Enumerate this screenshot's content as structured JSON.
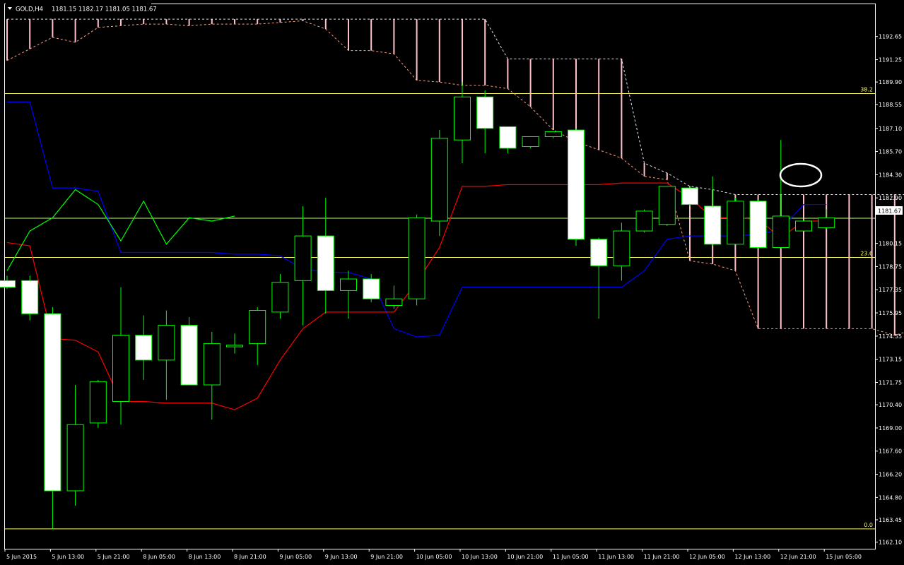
{
  "header": {
    "symbol_label": "GOLD,H4",
    "ohlc_label": "1181.15 1182.17 1181.05 1181.67",
    "dropdown_icon": "triangle-down-icon"
  },
  "colors": {
    "background": "#000000",
    "foreground": "#ffffff",
    "bull_border": "#00ff00",
    "bear_body": "#ffffff",
    "tenkan": "#ff0000",
    "kijun": "#0000ff",
    "chikou": "#00ff00",
    "cloud_hatch": "#ffc0cb",
    "cloud_edge_a": "#ffa07a",
    "cloud_edge_b": "#e6e6fa",
    "level_line": "#ffff66",
    "price_line": "#c0ff80"
  },
  "chart_data": {
    "type": "candlestick",
    "symbol": "GOLD",
    "timeframe": "H4",
    "ylim": [
      1161.7,
      1194.6
    ],
    "y_ticks": [
      "1192.65",
      "1191.25",
      "1189.90",
      "1188.55",
      "1187.10",
      "1185.70",
      "1184.30",
      "1182.90",
      "1181.67",
      "1180.15",
      "1178.75",
      "1177.35",
      "1175.95",
      "1174.55",
      "1173.15",
      "1171.75",
      "1170.40",
      "1169.00",
      "1167.60",
      "1166.20",
      "1164.80",
      "1163.45",
      "1162.10"
    ],
    "x_labels": [
      "5 Jun 2015",
      "5 Jun 13:00",
      "5 Jun 21:00",
      "8 Jun 05:00",
      "8 Jun 13:00",
      "8 Jun 21:00",
      "9 Jun 05:00",
      "9 Jun 13:00",
      "9 Jun 21:00",
      "10 Jun 05:00",
      "10 Jun 13:00",
      "10 Jun 21:00",
      "11 Jun 05:00",
      "11 Jun 13:00",
      "11 Jun 21:00",
      "12 Jun 05:00",
      "12 Jun 13:00",
      "12 Jun 21:00",
      "15 Jun 05:00"
    ],
    "current_price": "1181.67",
    "fib_levels": [
      {
        "label": "38.2",
        "price": 1189.2
      },
      {
        "label": "23.6",
        "price": 1179.3
      },
      {
        "label": "0.0",
        "price": 1162.9
      }
    ],
    "candles": [
      {
        "o": 1177.9,
        "h": 1178.2,
        "l": 1177.4,
        "c": 1177.5
      },
      {
        "o": 1177.9,
        "h": 1178.2,
        "l": 1175.5,
        "c": 1175.9
      },
      {
        "o": 1175.9,
        "h": 1176.3,
        "l": 1162.9,
        "c": 1165.2
      },
      {
        "o": 1165.2,
        "h": 1171.6,
        "l": 1164.3,
        "c": 1169.2
      },
      {
        "o": 1169.3,
        "h": 1171.9,
        "l": 1169.0,
        "c": 1171.8
      },
      {
        "o": 1170.6,
        "h": 1177.5,
        "l": 1169.2,
        "c": 1174.6
      },
      {
        "o": 1174.6,
        "h": 1175.8,
        "l": 1171.9,
        "c": 1173.1
      },
      {
        "o": 1173.1,
        "h": 1176.1,
        "l": 1170.7,
        "c": 1175.2
      },
      {
        "o": 1175.2,
        "h": 1175.7,
        "l": 1171.6,
        "c": 1171.6
      },
      {
        "o": 1171.6,
        "h": 1174.8,
        "l": 1169.5,
        "c": 1174.1
      },
      {
        "o": 1173.9,
        "h": 1174.7,
        "l": 1173.5,
        "c": 1174.0
      },
      {
        "o": 1174.1,
        "h": 1176.3,
        "l": 1172.8,
        "c": 1176.1
      },
      {
        "o": 1176.0,
        "h": 1178.3,
        "l": 1175.6,
        "c": 1177.8
      },
      {
        "o": 1177.9,
        "h": 1182.4,
        "l": 1175.2,
        "c": 1180.6
      },
      {
        "o": 1180.6,
        "h": 1182.9,
        "l": 1175.9,
        "c": 1177.3
      },
      {
        "o": 1177.3,
        "h": 1178.5,
        "l": 1175.6,
        "c": 1178.0
      },
      {
        "o": 1178.0,
        "h": 1178.3,
        "l": 1176.6,
        "c": 1176.8
      },
      {
        "o": 1176.4,
        "h": 1177.6,
        "l": 1176.2,
        "c": 1176.8
      },
      {
        "o": 1176.8,
        "h": 1181.9,
        "l": 1176.4,
        "c": 1181.7
      },
      {
        "o": 1181.5,
        "h": 1187.0,
        "l": 1180.6,
        "c": 1186.5
      },
      {
        "o": 1186.4,
        "h": 1189.9,
        "l": 1185.0,
        "c": 1189.0
      },
      {
        "o": 1189.0,
        "h": 1189.4,
        "l": 1185.6,
        "c": 1187.1
      },
      {
        "o": 1187.2,
        "h": 1187.2,
        "l": 1185.6,
        "c": 1185.9
      },
      {
        "o": 1186.0,
        "h": 1186.6,
        "l": 1185.9,
        "c": 1186.6
      },
      {
        "o": 1186.6,
        "h": 1186.9,
        "l": 1186.5,
        "c": 1186.9
      },
      {
        "o": 1187.0,
        "h": 1187.1,
        "l": 1180.0,
        "c": 1180.4
      },
      {
        "o": 1180.4,
        "h": 1180.5,
        "l": 1175.6,
        "c": 1178.8
      },
      {
        "o": 1178.8,
        "h": 1181.4,
        "l": 1177.9,
        "c": 1180.9
      },
      {
        "o": 1180.9,
        "h": 1182.2,
        "l": 1180.8,
        "c": 1182.1
      },
      {
        "o": 1181.3,
        "h": 1183.6,
        "l": 1181.2,
        "c": 1183.6
      },
      {
        "o": 1183.5,
        "h": 1183.6,
        "l": 1182.4,
        "c": 1182.5
      },
      {
        "o": 1182.4,
        "h": 1184.2,
        "l": 1180.0,
        "c": 1180.1
      },
      {
        "o": 1180.1,
        "h": 1182.9,
        "l": 1180.1,
        "c": 1182.7
      },
      {
        "o": 1182.7,
        "h": 1182.8,
        "l": 1179.9,
        "c": 1179.9
      },
      {
        "o": 1179.9,
        "h": 1186.4,
        "l": 1179.9,
        "c": 1181.8
      },
      {
        "o": 1180.9,
        "h": 1181.6,
        "l": 1180.9,
        "c": 1181.5
      },
      {
        "o": 1181.1,
        "h": 1182.2,
        "l": 1181.0,
        "c": 1181.7
      }
    ],
    "tenkan_sen": [
      1180.2,
      1180.0,
      1174.4,
      1174.3,
      1173.6,
      1170.6,
      1170.6,
      1170.5,
      1170.5,
      1170.5,
      1170.1,
      1170.8,
      1173.1,
      1175.0,
      1176.0,
      1176.0,
      1176.0,
      1176.0,
      1177.8,
      1179.9,
      1183.6,
      1183.6,
      1183.7,
      1183.7,
      1183.7,
      1183.7,
      1183.7,
      1183.8,
      1183.8,
      1183.8,
      1182.9,
      1181.7,
      1181.7,
      1181.6,
      1180.5,
      1181.5,
      1181.5
    ],
    "kijun_sen": [
      1188.7,
      1188.7,
      1183.5,
      1183.5,
      1183.3,
      1179.6,
      1179.6,
      1179.6,
      1179.6,
      1179.6,
      1179.5,
      1179.5,
      1179.4,
      1178.6,
      1178.4,
      1178.4,
      1178.0,
      1175.0,
      1174.5,
      1174.6,
      1177.5,
      1177.5,
      1177.5,
      1177.5,
      1177.5,
      1177.5,
      1177.5,
      1177.5,
      1178.5,
      1180.4,
      1180.6,
      1180.6,
      1180.6,
      1180.7,
      1181.0,
      1182.5,
      1182.5
    ],
    "chikou_span": [
      1178.5,
      1180.9,
      1181.7,
      1183.4,
      1182.5,
      1180.3,
      1182.7,
      1180.1,
      1181.7,
      1181.5,
      1181.8
    ],
    "senkou_span_a": [
      1191.2,
      1191.9,
      1192.6,
      1192.3,
      1193.2,
      1193.3,
      1193.4,
      1193.4,
      1193.3,
      1193.4,
      1193.4,
      1193.4,
      1193.5,
      1193.6,
      1193.1,
      1191.8,
      1191.8,
      1191.6,
      1190.0,
      1189.9,
      1189.7,
      1189.7,
      1189.5,
      1188.4,
      1187.0,
      1186.3,
      1185.8,
      1185.3,
      1184.2,
      1184.0,
      1179.1,
      1178.9,
      1178.5,
      1175.0,
      1175.0,
      1175.0,
      1175.0,
      1175.0,
      1175.0,
      1174.6,
      1175.0,
      1176.1
    ],
    "senkou_span_b": [
      1193.7,
      1193.7,
      1193.7,
      1193.7,
      1193.7,
      1193.7,
      1193.7,
      1193.7,
      1193.7,
      1193.7,
      1193.7,
      1193.7,
      1193.7,
      1193.7,
      1193.7,
      1193.7,
      1193.7,
      1193.7,
      1193.7,
      1193.7,
      1193.7,
      1193.7,
      1191.3,
      1191.3,
      1191.3,
      1191.3,
      1191.3,
      1191.3,
      1185.0,
      1184.4,
      1183.6,
      1183.4,
      1183.1,
      1183.1,
      1183.1,
      1183.1,
      1183.1,
      1183.1,
      1183.1,
      1183.1,
      1183.1,
      1183.1
    ]
  }
}
